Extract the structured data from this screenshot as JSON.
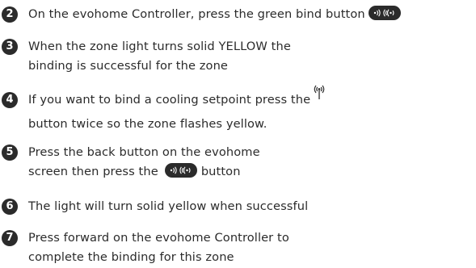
{
  "steps": [
    {
      "number": "2",
      "lines": [
        "On the evohome Controller, press the green bind button"
      ]
    },
    {
      "number": "3",
      "lines": [
        "When the zone light turns solid YELLOW the",
        "binding is successful for the zone"
      ]
    },
    {
      "number": "4",
      "lines": [
        "If you want to bind a cooling setpoint press the",
        "button twice so the zone flashes yellow."
      ]
    },
    {
      "number": "5",
      "lines": [
        "Press the back button on the evohome",
        "screen then press the",
        "button"
      ]
    },
    {
      "number": "6",
      "lines": [
        "The light will turn solid yellow when successful"
      ]
    },
    {
      "number": "7",
      "lines": [
        "Press forward on the evohome Controller to",
        "complete the binding for this zone"
      ]
    }
  ],
  "icons": {
    "bind_button": "bind-button-icon",
    "antenna": "antenna-icon"
  },
  "colors": {
    "text": "#2b2b2b",
    "badge": "#2b2b2b",
    "background": "#ffffff"
  }
}
